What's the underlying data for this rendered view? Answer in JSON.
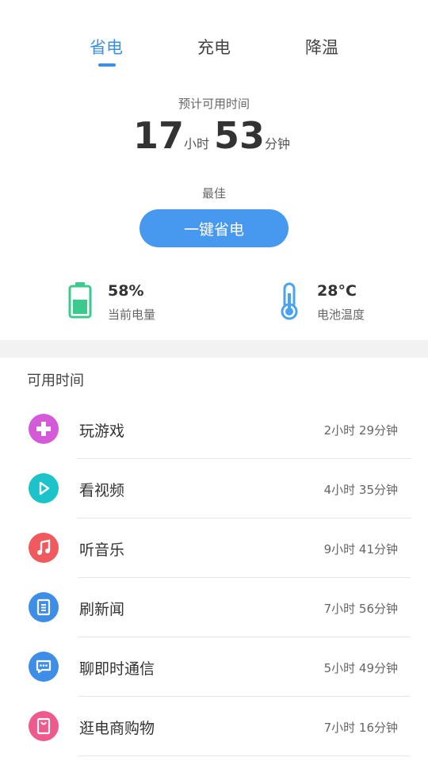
{
  "tabs": [
    {
      "label": "省电",
      "active": true
    },
    {
      "label": "充电",
      "active": false
    },
    {
      "label": "降温",
      "active": false
    }
  ],
  "estimate": {
    "label": "预计可用时间",
    "hours": "17",
    "hours_unit": "小时",
    "minutes": "53",
    "minutes_unit": "分钟"
  },
  "status": "最佳",
  "save_button": "一键省电",
  "battery": {
    "value": "58%",
    "label": "当前电量",
    "level": 0.58
  },
  "temperature": {
    "value": "28°C",
    "label": "电池温度"
  },
  "section_title": "可用时间",
  "usage": [
    {
      "name": "玩游戏",
      "duration": "2小时 29分钟",
      "icon": "gamepad-icon",
      "color": "#d45ad8"
    },
    {
      "name": "看视频",
      "duration": "4小时 35分钟",
      "icon": "play-icon",
      "color": "#1cc3c9"
    },
    {
      "name": "听音乐",
      "duration": "9小时 41分钟",
      "icon": "music-note-icon",
      "color": "#f05a5f"
    },
    {
      "name": "刷新闻",
      "duration": "7小时 56分钟",
      "icon": "news-icon",
      "color": "#3e8ee8"
    },
    {
      "name": "聊即时通信",
      "duration": "5小时 49分钟",
      "icon": "chat-icon",
      "color": "#3e8ee8"
    },
    {
      "name": "逛电商购物",
      "duration": "7小时 16分钟",
      "icon": "shopping-bag-icon",
      "color": "#ef5a8c"
    }
  ],
  "colors": {
    "accent": "#4699ef",
    "battery_green": "#3cc98d",
    "thermometer_blue": "#4aa3ef"
  }
}
